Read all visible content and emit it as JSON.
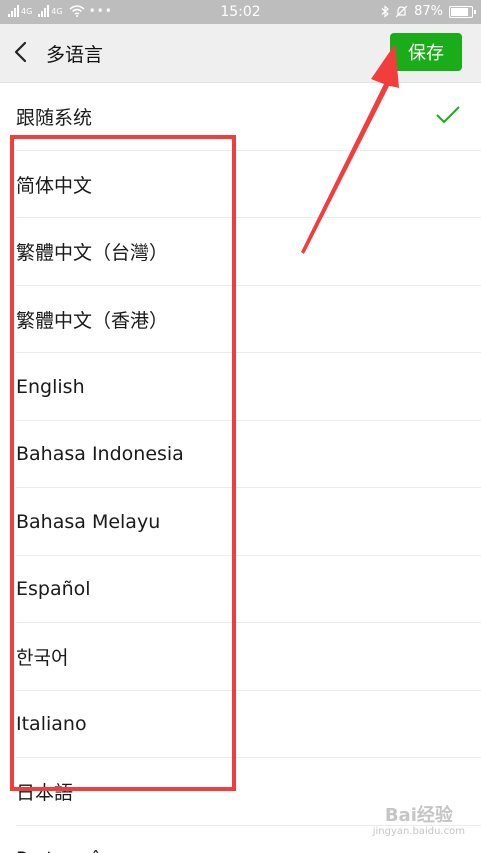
{
  "status_bar": {
    "time": "15:02",
    "battery_text": "87%",
    "battery_level": 0.87,
    "network_labels": [
      "4G",
      "4G"
    ],
    "icons": [
      "signal-icon",
      "wifi-icon",
      "more-icon",
      "bluetooth-icon",
      "mute-icon",
      "battery-icon"
    ]
  },
  "header": {
    "title": "多语言",
    "back_icon": "chevron-left-icon",
    "save_label": "保存",
    "accent_color": "#1aad19"
  },
  "languages": {
    "selected_index": 0,
    "check_color": "#1aad19",
    "items": [
      {
        "label": "跟随系统"
      },
      {
        "label": "简体中文"
      },
      {
        "label": "繁體中文（台灣）"
      },
      {
        "label": "繁體中文（香港）"
      },
      {
        "label": "English"
      },
      {
        "label": "Bahasa Indonesia"
      },
      {
        "label": "Bahasa Melayu"
      },
      {
        "label": "Español"
      },
      {
        "label": "한국어"
      },
      {
        "label": "Italiano"
      },
      {
        "label": "日本語"
      },
      {
        "label": "Português"
      }
    ]
  },
  "annotation": {
    "box_color": "#f23d3d",
    "arrow_color": "#f23d3d"
  },
  "watermark": {
    "text": "Bai经验",
    "sub": "jingyan.baidu.com"
  }
}
